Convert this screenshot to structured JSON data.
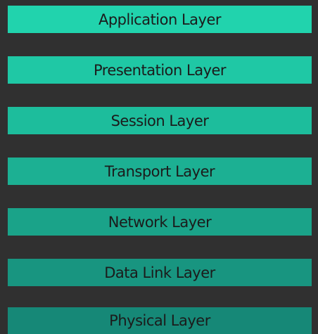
{
  "layers": [
    {
      "label": "Application Layer",
      "color": "#21d3ad"
    },
    {
      "label": "Presentation Layer",
      "color": "#1fc8a5"
    },
    {
      "label": "Session Layer",
      "color": "#1dbd9c"
    },
    {
      "label": "Transport Layer",
      "color": "#1cb093"
    },
    {
      "label": "Network Layer",
      "color": "#1aa389"
    },
    {
      "label": "Data Link Layer",
      "color": "#189580"
    },
    {
      "label": "Physical Layer",
      "color": "#168877"
    }
  ]
}
